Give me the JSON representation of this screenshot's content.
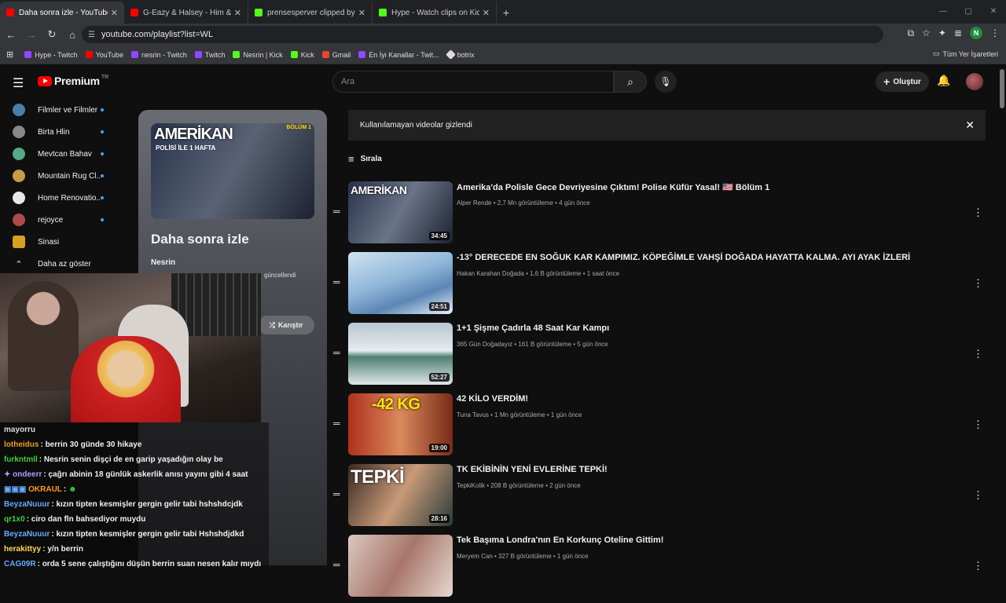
{
  "browser": {
    "tabs": [
      {
        "title": "Daha sonra izle - YouTube",
        "active": true,
        "favicon_color": "#ff0000"
      },
      {
        "title": "G-Eazy & Halsey - Him & I (Lyri",
        "active": false,
        "favicon_color": "#ff0000"
      },
      {
        "title": "prensesperver clipped by kreazi",
        "active": false,
        "favicon_color": "#53fc18"
      },
      {
        "title": "Hype - Watch clips on Kick",
        "active": false,
        "favicon_color": "#53fc18"
      }
    ],
    "url": "youtube.com/playlist?list=WL",
    "profile_initial": "N",
    "bookmarks": [
      {
        "label": "Hype - Twitch",
        "color": "#9146ff"
      },
      {
        "label": "YouTube",
        "color": "#ff0000"
      },
      {
        "label": "nesrin - Twitch",
        "color": "#9146ff"
      },
      {
        "label": "Twitch",
        "color": "#9146ff"
      },
      {
        "label": "Nesrin | Kick",
        "color": "#53fc18"
      },
      {
        "label": "Kick",
        "color": "#53fc18"
      },
      {
        "label": "Gmail",
        "color": "#ea4335"
      },
      {
        "label": "En İyi Kanallar - Twit...",
        "color": "#9146ff"
      },
      {
        "label": "botrix",
        "color": "#dddddd"
      }
    ],
    "all_bookmarks": "Tüm Yer İşaretleri"
  },
  "youtube": {
    "logo_text": "Premium",
    "logo_region": "TR",
    "search_placeholder": "Ara",
    "create_label": "Oluştur",
    "sidebar": [
      {
        "label": "Filmler ve Filmler",
        "color": "#4a7fa8"
      },
      {
        "label": "Birta Hlin",
        "color": "#888888"
      },
      {
        "label": "Mevtcan Bahav",
        "color": "#5a8"
      },
      {
        "label": "Mountain Rug Cl...",
        "color": "#c89a4a"
      },
      {
        "label": "Home Renovatio...",
        "color": "#e8e8e8"
      },
      {
        "label": "rejoyce",
        "color": "#b04a4a"
      },
      {
        "label": "Sinasi",
        "color": "#d8a020"
      }
    ],
    "show_less": "Daha az göster",
    "playlist": {
      "thumb_title": "AMERİKAN",
      "thumb_subtitle": "POLİSİ İLE 1 HAFTA",
      "thumb_tag": "BÖLÜM 1",
      "title": "Daha sonra izle",
      "owner": "Nesrin",
      "updated": "güncellendi",
      "shuffle_label": "Karıştır"
    },
    "banner": "Kullanılamayan videolar gizlendi",
    "sort_label": "Sırala",
    "videos": [
      {
        "title": "Amerika'da Polisle Gece Devriyesine Çıktım! Polise Küfür Yasal! 🇺🇸 Bölüm 1",
        "channel": "Alper Rende",
        "views": "2,7 Mn görüntüleme",
        "age": "4 gün önce",
        "duration": "34:45",
        "overlay": "AMERİKAN",
        "bg": "linear-gradient(120deg,#28334a,#6a7488 50%,#1d2230)"
      },
      {
        "title": "-13° DERECEDE EN SOĞUK KAR KAMPIMIZ. KÖPEĞİMLE VAHŞİ DOĞADA HAYATTA KALMA. AYI AYAK İZLERİ",
        "channel": "Hakan Karahan Doğada",
        "views": "1,6 B görüntüleme",
        "age": "1 saat önce",
        "duration": "24:51",
        "overlay": "",
        "bg": "linear-gradient(160deg,#cfe3f3,#8fb6d8 45%,#5b86b5 70%,#e9f2fb)"
      },
      {
        "title": "1+1 Şişme Çadırla 48 Saat Kar Kampı",
        "channel": "365 Gün Doğadayız",
        "views": "161 B görüntüleme",
        "age": "5 gün önce",
        "duration": "52:27",
        "overlay": "",
        "bg": "linear-gradient(180deg,#b8c6cf,#e6ecef 45%,#4d7f72 55%,#dfe7ea)"
      },
      {
        "title": "42 KİLO VERDİM!",
        "channel": "Tuna Tavus",
        "views": "1 Mn görüntüleme",
        "age": "1 gün önce",
        "duration": "19:00",
        "overlay": "-42 KG",
        "bg": "linear-gradient(90deg,#b0301d,#d98a5c 50%,#7a2a18)"
      },
      {
        "title": "TK EKİBİNİN YENİ EVLERİNE TEPKİ!",
        "channel": "TepkiKolik",
        "views": "208 B görüntüleme",
        "age": "2 gün önce",
        "duration": "28:16",
        "overlay": "TEPKİ",
        "bg": "linear-gradient(120deg,#3a2a22,#c89a78 50%,#2a3a3a)"
      },
      {
        "title": "Tek Başıma Londra'nın En Korkunç Oteline Gittim!",
        "channel": "Meryem Can",
        "views": "327 B görüntüleme",
        "age": "1 gün önce",
        "duration": "",
        "overlay": "",
        "bg": "linear-gradient(120deg,#d9c9c0,#a8766a 50%,#e6d8d0)"
      }
    ]
  },
  "chat": [
    {
      "user": "mayorru",
      "color": "#dddddd",
      "text": ""
    },
    {
      "user": "lotheidus",
      "color": "#e8a020",
      "text": "berrin 30 günde 30 hikaye"
    },
    {
      "user": "furkntmll",
      "color": "#3ecf3e",
      "text": "Nesrin senin dişçi de en garip yaşadığın olay be"
    },
    {
      "user": "ondeerr",
      "color": "#b69aff",
      "text": "çağrı abinin 18 günlük askerlik anısı yayını gibi 4 saat"
    },
    {
      "user": "OKRAUL",
      "color": "#ff9a1a",
      "text": ""
    },
    {
      "user": "BeyzaNuuur",
      "color": "#6aa9ff",
      "text": "kızın tipten kesmişler gergin gelir tabi hshshdcjdk"
    },
    {
      "user": "qr1x0",
      "color": "#3ecf3e",
      "text": "ciro dan fln bahsediyor muydu"
    },
    {
      "user": "BeyzaNuuur",
      "color": "#6aa9ff",
      "text": "kızın tipten kesmişler gergin gelir tabi Hshshdjdkd"
    },
    {
      "user": "herakittyy",
      "color": "#ffd84a",
      "text": "y/n berrin"
    },
    {
      "user": "CAG09R",
      "color": "#6aa9ff",
      "text": "orda 5 sene çalıştığını düşün berrin suan nesen kalır mıydı"
    }
  ]
}
